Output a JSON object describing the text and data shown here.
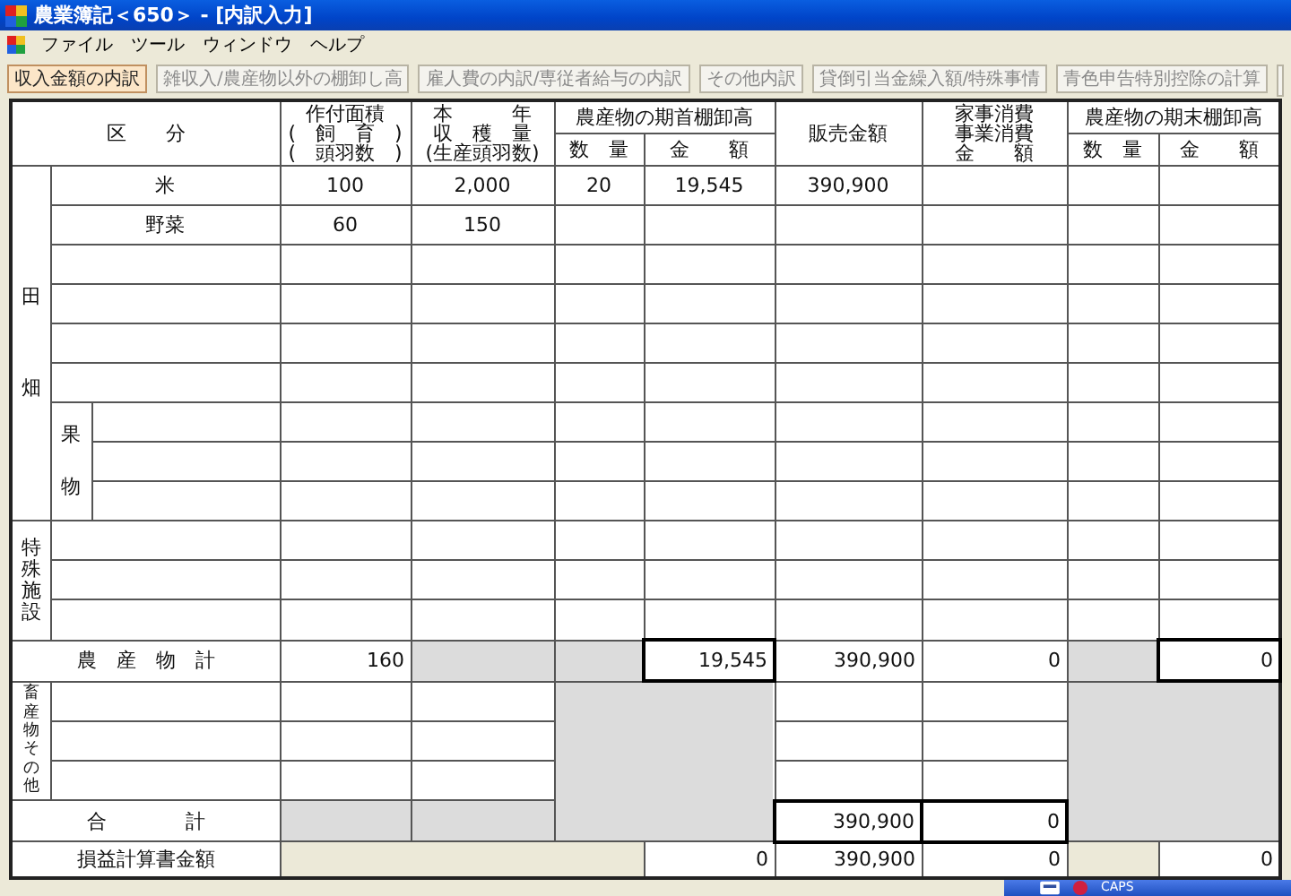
{
  "window": {
    "title": "農業簿記＜650＞ - [内訳入力]"
  },
  "menu": [
    "ファイル",
    "ツール",
    "ウィンドウ",
    "ヘルプ"
  ],
  "tabs": [
    {
      "label": "収入金額の内訳",
      "selected": true
    },
    {
      "label": "雑収入/農産物以外の棚卸し高",
      "selected": false
    },
    {
      "label": "雇人費の内訳/専従者給与の内訳",
      "selected": false
    },
    {
      "label": "その他内訳",
      "selected": false
    },
    {
      "label": "貸倒引当金繰入額/特殊事情",
      "selected": false
    },
    {
      "label": "青色申告特別控除の計算",
      "selected": false
    }
  ],
  "table": {
    "headers": {
      "category": "区　　分",
      "planted_area": [
        "作付面積",
        "(　飼　育　)",
        "(　頭羽数　)"
      ],
      "harvest": [
        "本　　　年",
        "収　穫　量",
        "(生産頭羽数)"
      ],
      "opening_inventory": "農産物の期首棚卸高",
      "opening_qty": "数　量",
      "opening_amount": "金　　額",
      "sales": "販売金額",
      "consumption": [
        "家事消費",
        "事業消費",
        "金　　額"
      ],
      "closing_inventory": "農産物の期末棚卸高",
      "closing_qty": "数　量",
      "closing_amount": "金　　額"
    },
    "groups": [
      {
        "kind": "crop_section",
        "label": "田畑",
        "rows": [
          {
            "name": "米",
            "area": "100",
            "harvest": "2,000",
            "opening_qty": "20",
            "opening_amount": "19,545",
            "sales": "390,900"
          },
          {
            "name": "野菜",
            "area": "60",
            "harvest": "150"
          },
          {},
          {},
          {},
          {}
        ],
        "sub": {
          "label": "果物",
          "rows": [
            {},
            {},
            {}
          ]
        }
      },
      {
        "kind": "section",
        "label": "特殊施設",
        "rows": [
          {},
          {},
          {}
        ]
      },
      {
        "kind": "subtotal",
        "label": "農　産　物　計",
        "area": "160",
        "opening_amount": "19,545",
        "sales": "390,900",
        "consumption": "0",
        "closing_amount": "0"
      },
      {
        "kind": "livestock_section",
        "label": "畜産物その他",
        "rows": [
          {},
          {},
          {}
        ]
      },
      {
        "kind": "total",
        "label": "合　　　　計",
        "sales": "390,900",
        "consumption": "0"
      },
      {
        "kind": "pl",
        "label": "損益計算書金額",
        "opening_amount": "0",
        "sales": "390,900",
        "consumption": "0",
        "closing_amount": "0"
      }
    ]
  },
  "language_bar": {
    "caps": "CAPS"
  }
}
